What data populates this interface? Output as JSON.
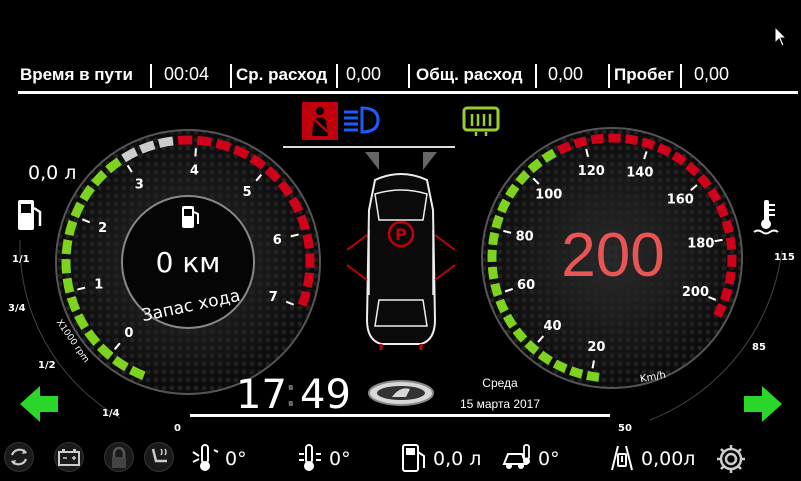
{
  "topbar": {
    "items": [
      {
        "label": "Время в пути",
        "value": "00:04"
      },
      {
        "label": "Ср. расход",
        "value": "0,00"
      },
      {
        "label": "Общ. расход",
        "value": "0,00"
      },
      {
        "label": "Пробег",
        "value": "0,00"
      }
    ]
  },
  "tacho": {
    "ticks": [
      "0",
      "1",
      "2",
      "3",
      "4",
      "5",
      "6",
      "7"
    ],
    "range_label": "Запас хода",
    "range_value": "0 км",
    "unit": "X1000 rpm"
  },
  "speedo": {
    "ticks": [
      "20",
      "40",
      "60",
      "80",
      "100",
      "120",
      "140",
      "160",
      "180",
      "200"
    ],
    "speed": "200",
    "unit": "Km/h"
  },
  "fuel": {
    "value": "0,0 л",
    "scale": [
      "1/1",
      "3/4",
      "1/2",
      "1/4",
      "0"
    ]
  },
  "temp": {
    "scale": [
      "115",
      "85",
      "50"
    ]
  },
  "clock": {
    "hours": "17",
    "minutes": "49",
    "day": "Среда",
    "date": "15 марта 2017"
  },
  "bottom": {
    "outside_temp": "0°",
    "coolant_temp": "0°",
    "fuel_level": "0,0 л",
    "car_temp": "0°",
    "fuel_used": "0,00л"
  },
  "parking_symbol": "P",
  "colors": {
    "green": "#7ed321",
    "red": "#d0021b",
    "speed_text": "#e85555",
    "indicator_blue": "#1e5bff",
    "indicator_green": "#9acd32"
  }
}
